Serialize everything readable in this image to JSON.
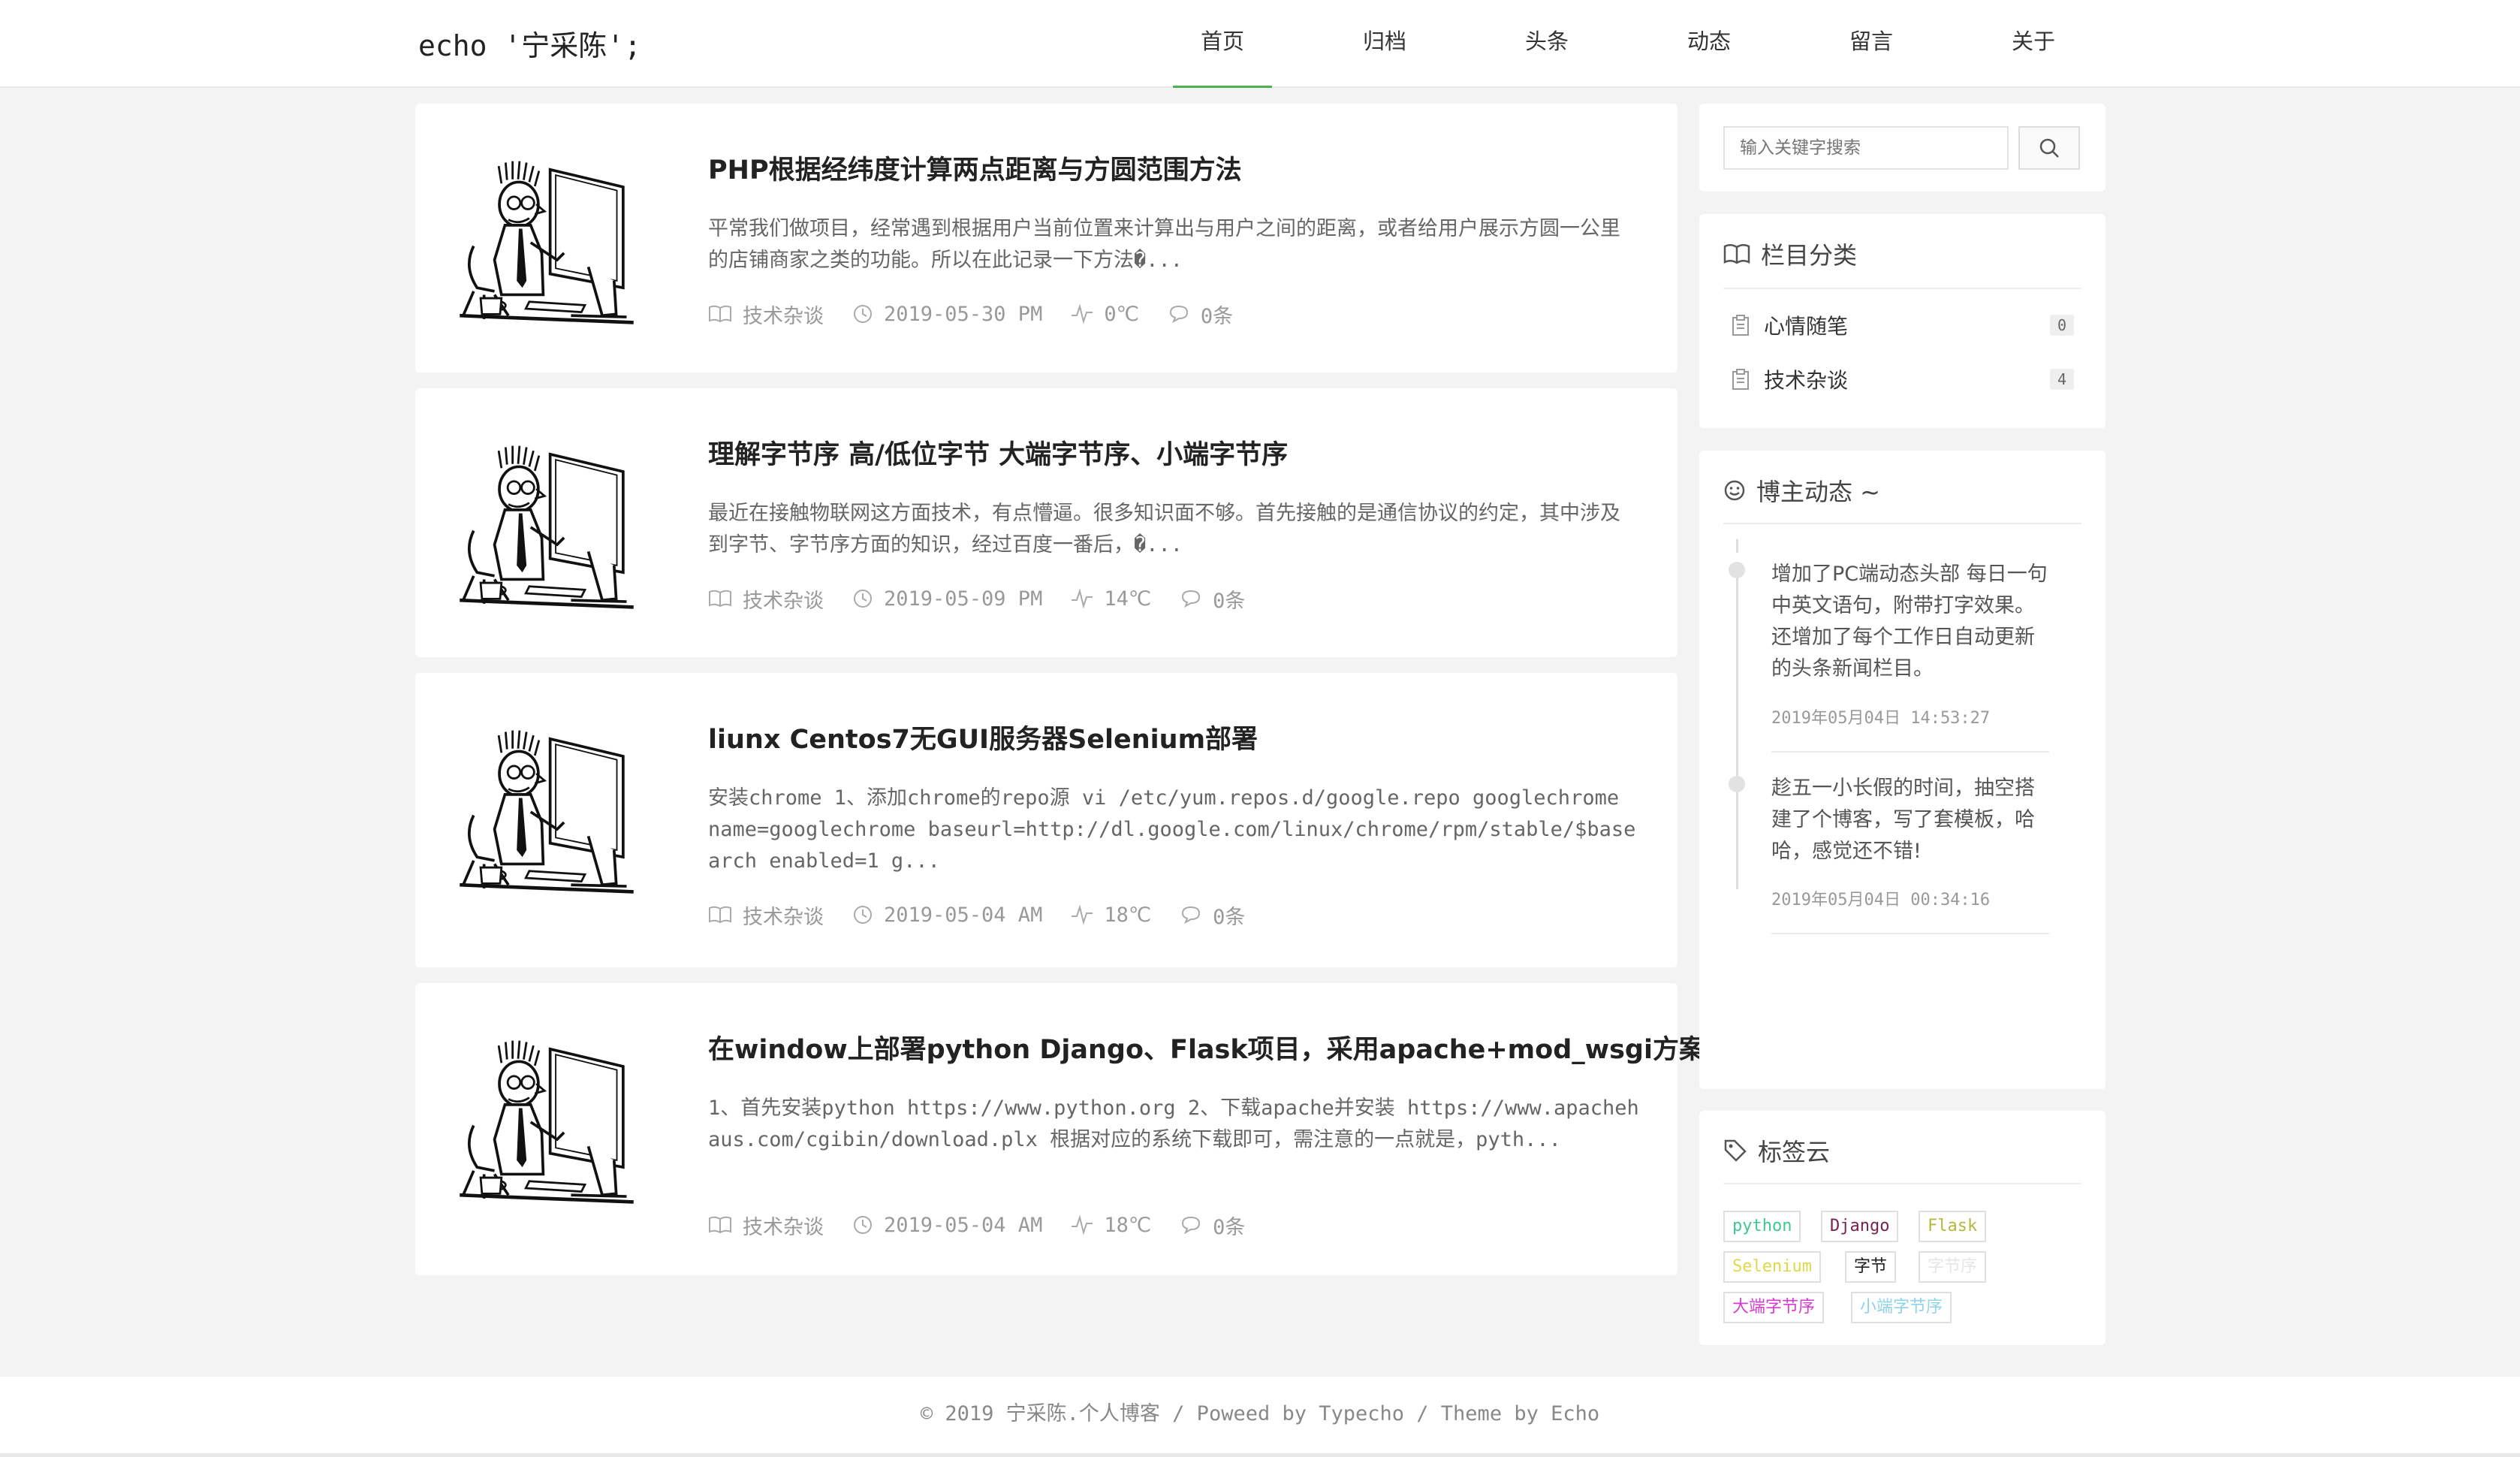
{
  "header": {
    "logo": "echo '宁采陈';",
    "nav": [
      {
        "label": "首页",
        "active": true
      },
      {
        "label": "归档"
      },
      {
        "label": "头条"
      },
      {
        "label": "动态"
      },
      {
        "label": "留言"
      },
      {
        "label": "关于"
      }
    ]
  },
  "posts": [
    {
      "title": "PHP根据经纬度计算两点距离与方圆范围方法",
      "excerpt": "平常我们做项目，经常遇到根据用户当前位置来计算出与用户之间的距离，或者给用户展示方圆一公里的店铺商家之类的功能。所以在此记录一下方法�...",
      "category": "技术杂谈",
      "date": "2019-05-30 PM",
      "temp": "0℃",
      "comments": "0条"
    },
    {
      "title": "理解字节序 高/低位字节 大端字节序、小端字节序",
      "excerpt": "最近在接触物联网这方面技术，有点懵逼。很多知识面不够。首先接触的是通信协议的约定，其中涉及到字节、字节序方面的知识，经过百度一番后，�...",
      "category": "技术杂谈",
      "date": "2019-05-09 PM",
      "temp": "14℃",
      "comments": "0条"
    },
    {
      "title": "liunx Centos7无GUI服务器Selenium部署",
      "excerpt": "安装chrome 1、添加chrome的repo源 vi /etc/yum.repos.d/google.repo googlechrome name=googlechrome baseurl=http://dl.google.com/linux/chrome/rpm/stable/$basearch enabled=1 g...",
      "category": "技术杂谈",
      "date": "2019-05-04 AM",
      "temp": "18℃",
      "comments": "0条"
    },
    {
      "title": "在window上部署python Django、Flask项目，采用apache+mod_wsgi方案",
      "excerpt": "1、首先安装python https://www.python.org 2、下载apache并安装 https://www.apachehaus.com/cgibin/download.plx 根据对应的系统下载即可，需注意的一点就是，pyth...",
      "category": "技术杂谈",
      "date": "2019-05-04 AM",
      "temp": "18℃",
      "comments": "0条"
    }
  ],
  "sidebar": {
    "search_placeholder": "输入关键字搜索",
    "categories_title": "栏目分类",
    "categories": [
      {
        "name": "心情随笔",
        "count": "0"
      },
      {
        "name": "技术杂谈",
        "count": "4"
      }
    ],
    "feed_title": "博主动态 ~",
    "feed": [
      {
        "text": "增加了PC端动态头部 每日一句中英文语句，附带打字效果。还增加了每个工作日自动更新的头条新闻栏目。",
        "time": "2019年05月04日 14:53:27"
      },
      {
        "text": "趁五一小长假的时间，抽空搭建了个博客，写了套模板，哈哈，感觉还不错!",
        "time": "2019年05月04日 00:34:16"
      }
    ],
    "tags_title": "标签云",
    "tags": [
      {
        "label": "python",
        "color": "#3ec98f"
      },
      {
        "label": "Django",
        "color": "#7a1f4e"
      },
      {
        "label": "Flask",
        "color": "#b5b83a"
      },
      {
        "label": "Selenium",
        "color": "#e0d84a"
      },
      {
        "label": "字节",
        "color": "#222222"
      },
      {
        "label": "字节序",
        "color": "#e6e6e6"
      },
      {
        "label": "大端字节序",
        "color": "#d63bd0"
      },
      {
        "label": "小端字节序",
        "color": "#8fd3e8"
      }
    ]
  },
  "footer": {
    "text": "© 2019 宁采陈.个人博客 / Poweed by Typecho / Theme by Echo"
  }
}
